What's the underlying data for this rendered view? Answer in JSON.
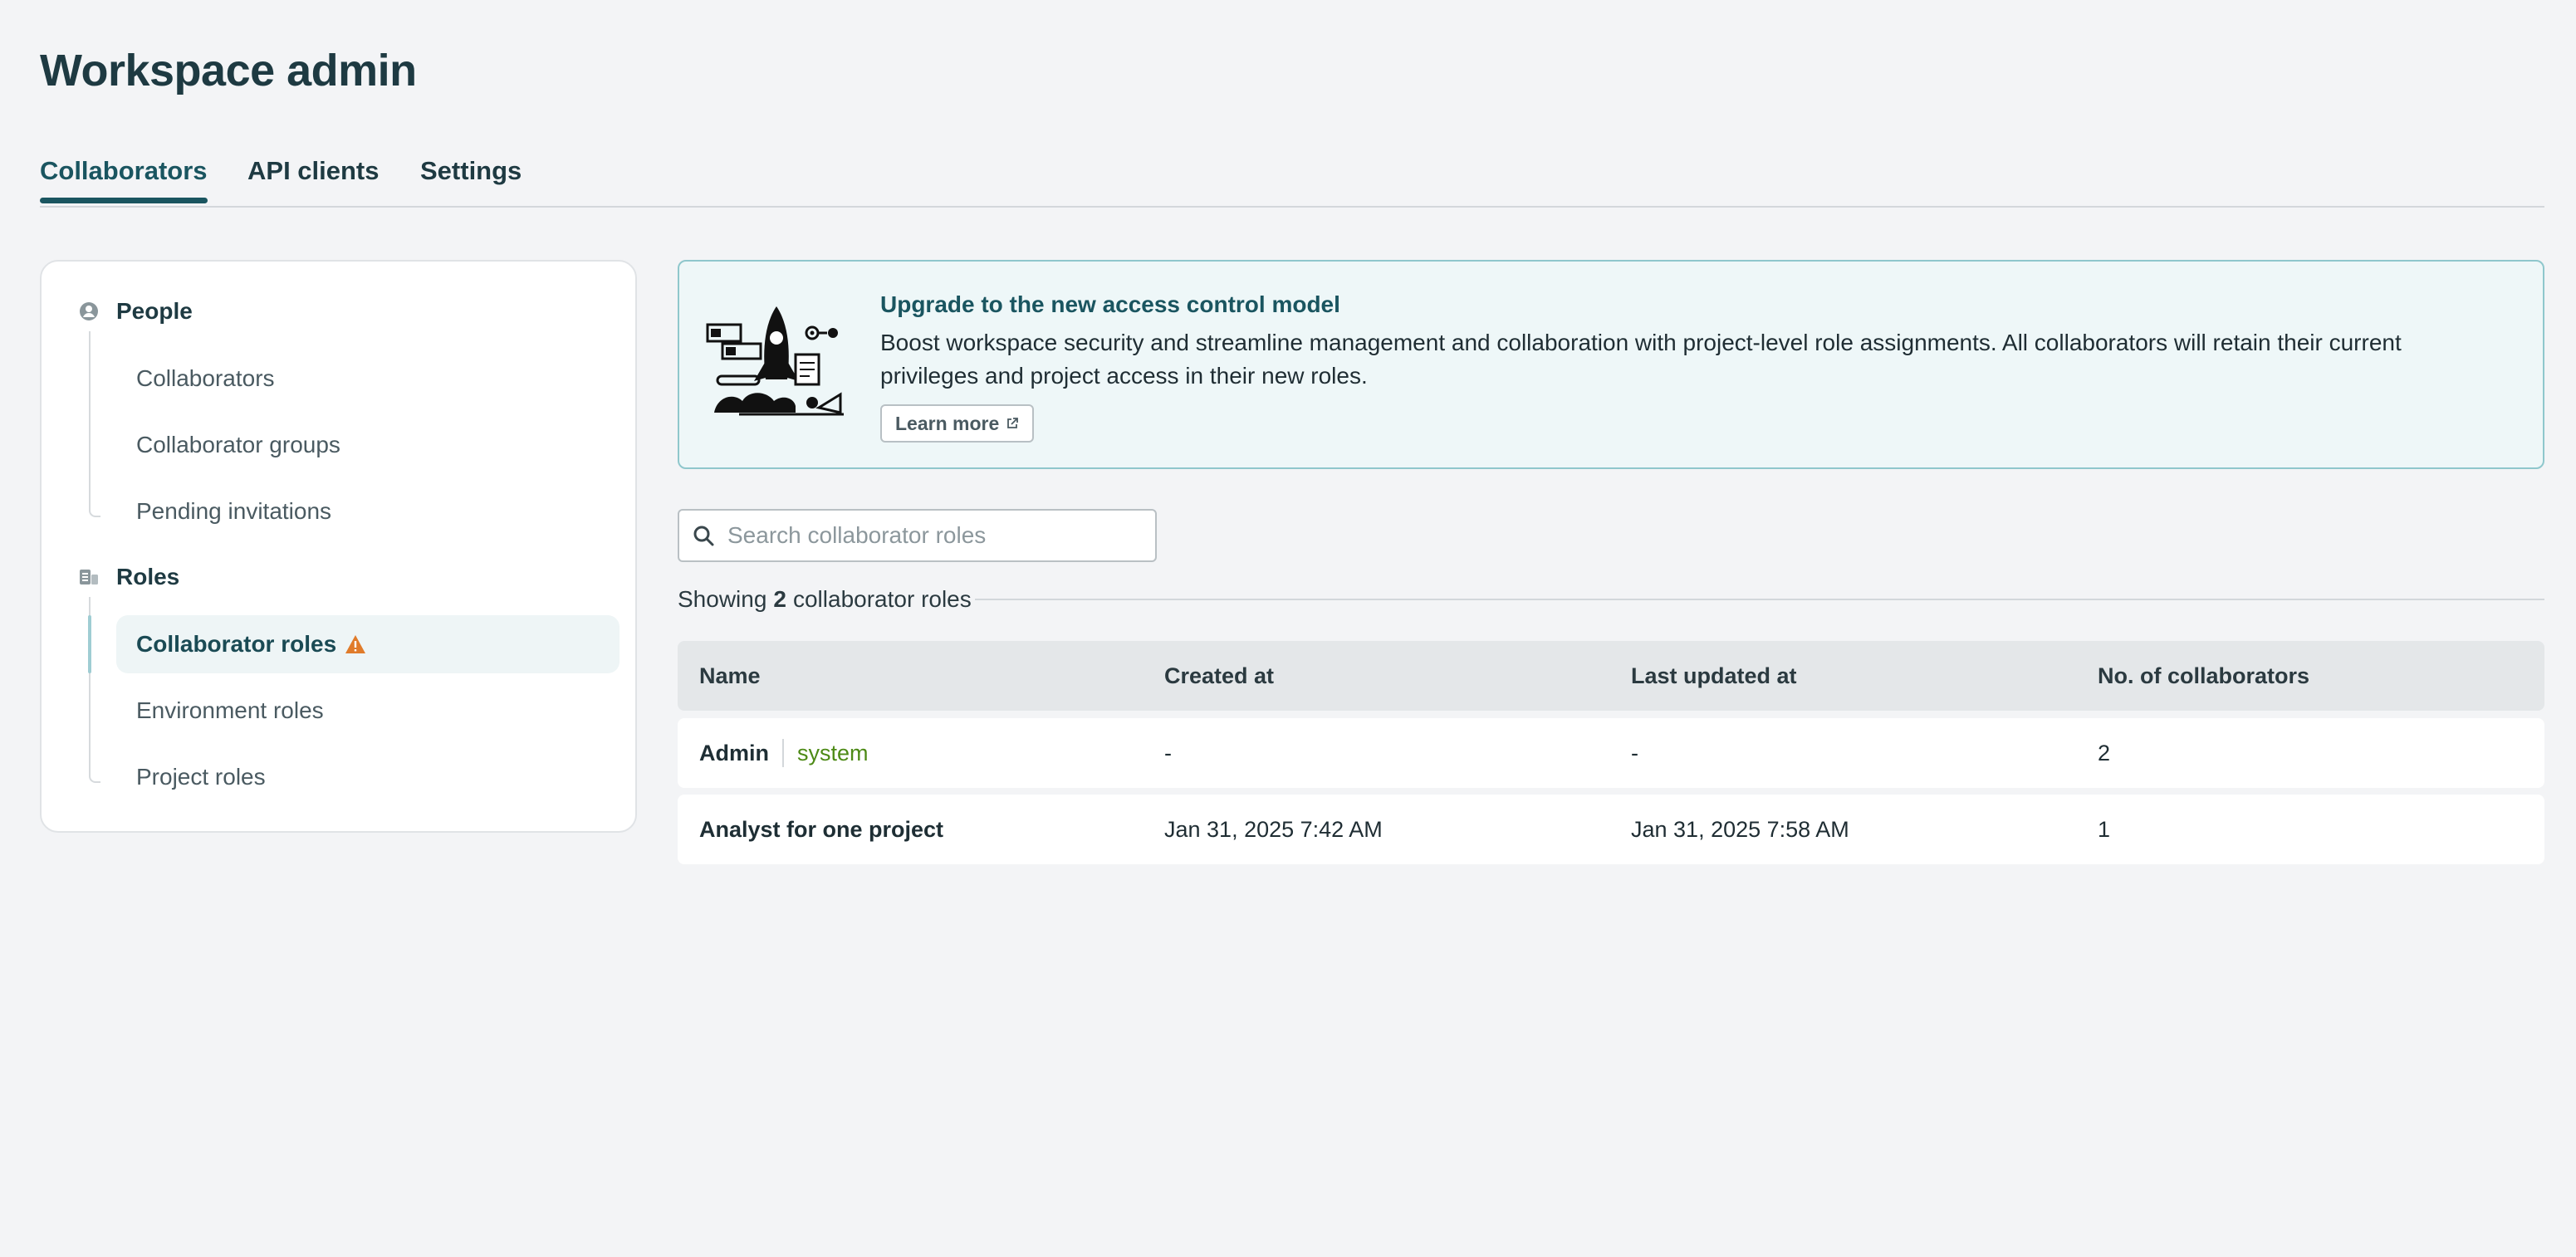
{
  "page": {
    "title": "Workspace admin"
  },
  "tabs": [
    {
      "label": "Collaborators",
      "active": true
    },
    {
      "label": "API clients",
      "active": false
    },
    {
      "label": "Settings",
      "active": false
    }
  ],
  "sidebar": {
    "people": {
      "label": "People",
      "icon": "user-circle-icon",
      "items": [
        "Collaborators",
        "Collaborator groups",
        "Pending invitations"
      ]
    },
    "roles": {
      "label": "Roles",
      "icon": "roles-icon",
      "items": [
        "Collaborator roles",
        "Environment roles",
        "Project roles"
      ],
      "active": "Collaborator roles",
      "active_icon": "warning-icon"
    }
  },
  "banner": {
    "title": "Upgrade to the new access control model",
    "body": "Boost workspace security and streamline management and collaboration with project-level role assignments. All collaborators will retain their current privileges and project access in their new roles.",
    "button": "Learn more",
    "illustration": "rocket-illustration"
  },
  "search": {
    "placeholder": "Search collaborator roles",
    "value": ""
  },
  "summary": {
    "prefix": "Showing",
    "count": "2",
    "suffix": "collaborator roles"
  },
  "table": {
    "columns": [
      "Name",
      "Created at",
      "Last updated at",
      "No. of collaborators"
    ],
    "rows": [
      {
        "name": "Admin",
        "badge": "system",
        "created": "-",
        "updated": "-",
        "count": "2"
      },
      {
        "name": "Analyst for one project",
        "badge": "",
        "created": "Jan 31, 2025 7:42 AM",
        "updated": "Jan 31, 2025 7:58 AM",
        "count": "1"
      }
    ]
  },
  "colors": {
    "accent": "#1a5560",
    "banner_border": "#8fc7cc",
    "system_badge": "#4d8a16",
    "warning": "#e07b2a"
  }
}
